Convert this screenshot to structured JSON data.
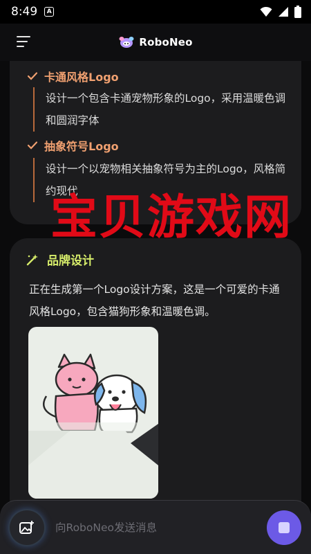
{
  "status_bar": {
    "time": "8:49",
    "app_badge": "A"
  },
  "header": {
    "brand": "RoboNeo"
  },
  "options": [
    {
      "title": "卡通风格Logo",
      "desc": "设计一个包含卡通宠物形象的Logo，采用温暖色调和圆润字体"
    },
    {
      "title": "抽象符号Logo",
      "desc": "设计一个以宠物相关抽象符号为主的Logo，风格简约现代"
    }
  ],
  "section": {
    "title": "品牌设计",
    "text": "正在生成第一个Logo设计方案，这是一个可爱的卡通风格Logo，包含猫狗形象和温暖色调。"
  },
  "watermark": "宝贝游戏网",
  "input": {
    "placeholder": "向RoboNeo发送消息"
  },
  "colors": {
    "accent_orange": "#f0a070",
    "accent_green": "#d6ec6a",
    "send_purple": "#6c5ae6",
    "watermark_red": "#e10a17"
  }
}
